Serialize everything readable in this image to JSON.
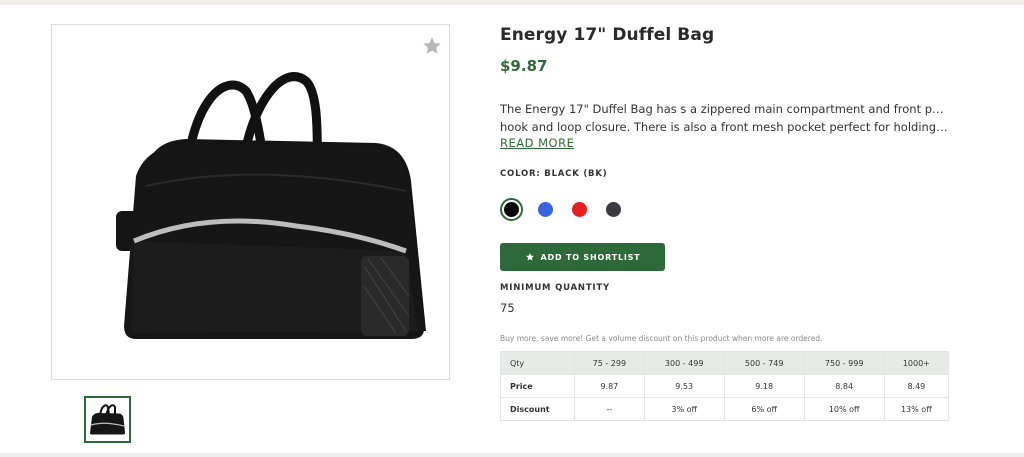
{
  "product": {
    "title": "Energy 17\" Duffel Bag",
    "price": "$9.87",
    "description_line1": "The Energy 17\" Duffel Bag has s a zippered main compartment and front pocket with",
    "description_line2": "hook and loop closure. There is also a front mesh pocket perfect for holding a water…",
    "read_more": "READ MORE",
    "favorite_icon": "star-icon"
  },
  "color": {
    "label": "COLOR: BLACK (BK)",
    "swatches": [
      {
        "name": "black",
        "hex": "#000000",
        "selected": true
      },
      {
        "name": "blue",
        "hex": "#3a64dc",
        "selected": false
      },
      {
        "name": "red",
        "hex": "#e41f1f",
        "selected": false
      },
      {
        "name": "charcoal",
        "hex": "#3a3a40",
        "selected": false
      }
    ]
  },
  "shortlist": {
    "button_label": "ADD TO SHORTLIST",
    "icon": "star-icon"
  },
  "minimum": {
    "label": "MINIMUM QUANTITY",
    "value": "75"
  },
  "pricing": {
    "note": "Buy more, save more! Get a volume discount on this product when more are ordered.",
    "header": [
      "Qty",
      "75 - 299",
      "300 - 499",
      "500 - 749",
      "750 - 999",
      "1000+"
    ],
    "price_row": [
      "Price",
      "9.87",
      "9.53",
      "9.18",
      "8.84",
      "8.49"
    ],
    "discount_row": [
      "Discount",
      "--",
      "3% off",
      "6% off",
      "10% off",
      "13% off"
    ]
  },
  "theme": {
    "accent": "#2e6a39",
    "table_header_bg": "#e7ebe8"
  }
}
